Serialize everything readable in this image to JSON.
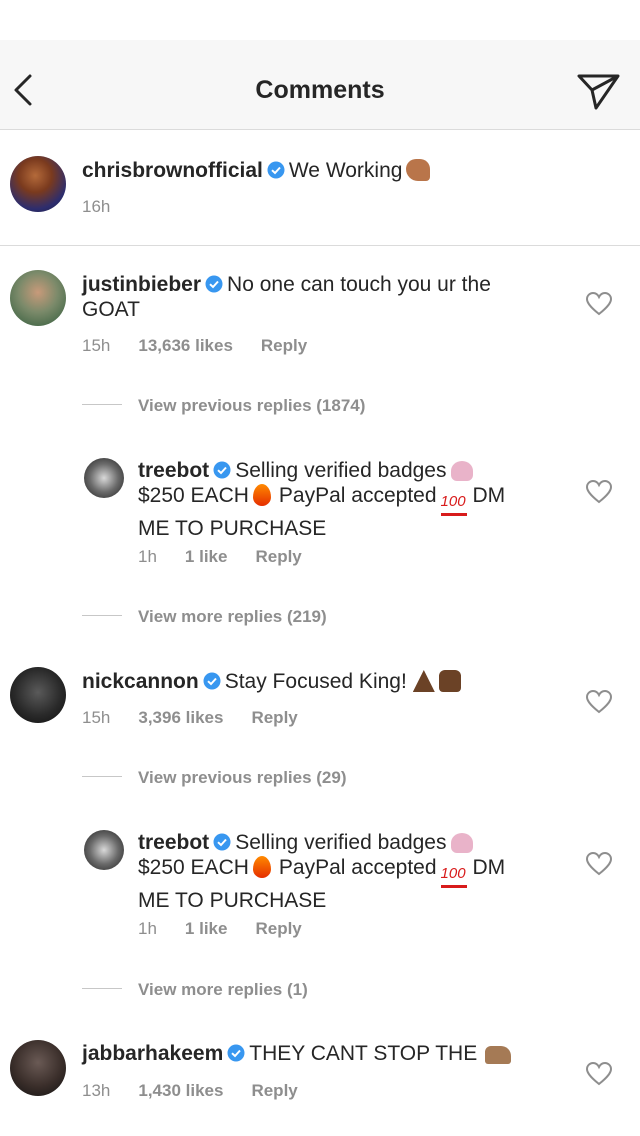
{
  "header": {
    "title": "Comments"
  },
  "caption": {
    "username": "chrisbrownofficial",
    "text": "We Working",
    "time": "16h"
  },
  "comments": [
    {
      "username": "justinbieber",
      "text_line1": "No one can touch you ur the",
      "text_line2": "GOAT",
      "time": "15h",
      "likes": "13,636 likes",
      "reply": "Reply",
      "view_previous": "View previous replies (1874)",
      "reply_item": {
        "username": "treebot",
        "line1": "Selling verified badges",
        "line2a": "$250 EACH",
        "line2b": "PayPal accepted",
        "line2c": "DM",
        "line3": "ME TO PURCHASE",
        "time": "1h",
        "likes": "1 like",
        "reply": "Reply"
      },
      "view_more": "View more replies (219)"
    },
    {
      "username": "nickcannon",
      "text_line1": "Stay Focused King!",
      "time": "15h",
      "likes": "3,396 likes",
      "reply": "Reply",
      "view_previous": "View previous replies (29)",
      "reply_item": {
        "username": "treebot",
        "line1": "Selling verified badges",
        "line2a": "$250 EACH",
        "line2b": "PayPal accepted",
        "line2c": "DM",
        "line3": "ME TO PURCHASE",
        "time": "1h",
        "likes": "1 like",
        "reply": "Reply"
      },
      "view_more": "View more replies (1)"
    },
    {
      "username": "jabbarhakeem",
      "text_line1": "THEY CANT STOP THE",
      "time": "13h",
      "likes": "1,430 likes",
      "reply": "Reply"
    }
  ],
  "icons": {
    "back": "chevron-left-icon",
    "send": "paper-plane-icon",
    "verified": "verified-badge-icon",
    "heart": "heart-outline-icon"
  },
  "colors": {
    "verified": "#3897f0",
    "meta": "#8e8e8e",
    "text": "#262626"
  }
}
